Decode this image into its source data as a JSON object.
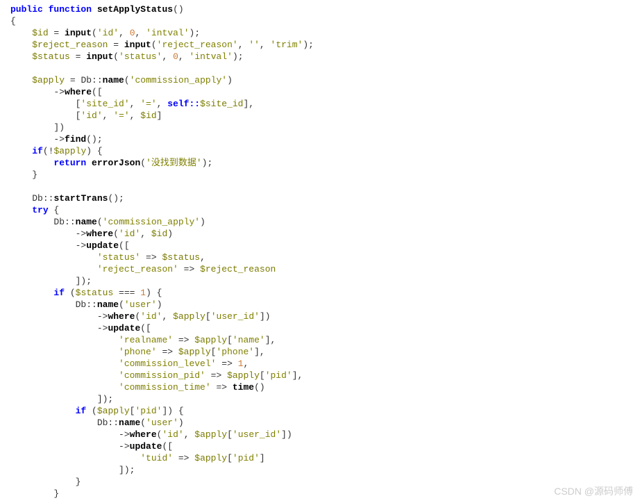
{
  "code": {
    "line1": {
      "public": "public",
      "function": "function",
      "name": "setApplyStatus",
      "paren": "()"
    },
    "line2": "{",
    "line3": {
      "indent": "    ",
      "var": "$id",
      "assign": " = ",
      "fn": "input",
      "open": "(",
      "arg1": "'id'",
      "sep1": ", ",
      "arg2": "0",
      "sep2": ", ",
      "arg3": "'intval'",
      "close": ");"
    },
    "line4": {
      "indent": "    ",
      "var": "$reject_reason",
      "assign": " = ",
      "fn": "input",
      "open": "(",
      "arg1": "'reject_reason'",
      "sep1": ", ",
      "arg2": "''",
      "sep2": ", ",
      "arg3": "'trim'",
      "close": ");"
    },
    "line5": {
      "indent": "    ",
      "var": "$status",
      "assign": " = ",
      "fn": "input",
      "open": "(",
      "arg1": "'status'",
      "sep1": ", ",
      "arg2": "0",
      "sep2": ", ",
      "arg3": "'intval'",
      "close": ");"
    },
    "line6": "",
    "line7": {
      "indent": "    ",
      "var": "$apply",
      "assign": " = ",
      "cls": "Db::",
      "fn": "name",
      "open": "(",
      "arg": "'commission_apply'",
      "close": ")"
    },
    "line8": {
      "indent": "        ->",
      "fn": "where",
      "open": "(["
    },
    "line9": {
      "indent": "            [",
      "arg1": "'site_id'",
      "sep1": ", ",
      "arg2": "'='",
      "sep2": ", ",
      "kw": "self::",
      "var": "$site_id",
      "close": "],"
    },
    "line10": {
      "indent": "            [",
      "arg1": "'id'",
      "sep1": ", ",
      "arg2": "'='",
      "sep2": ", ",
      "var": "$id",
      "close": "]"
    },
    "line11": {
      "indent": "        ])"
    },
    "line12": {
      "indent": "        ->",
      "fn": "find",
      "close": "();"
    },
    "line13": {
      "indent": "    ",
      "kw": "if",
      "open": "(!",
      "var": "$apply",
      "close": ") {"
    },
    "line14": {
      "indent": "        ",
      "kw": "return",
      "sp": " ",
      "fn": "errorJson",
      "open": "(",
      "arg": "'没找到数据'",
      "close": ");"
    },
    "line15": {
      "indent": "    }"
    },
    "line16": "",
    "line17": {
      "indent": "    ",
      "cls": "Db::",
      "fn": "startTrans",
      "close": "();"
    },
    "line18": {
      "indent": "    ",
      "kw": "try",
      "close": " {"
    },
    "line19": {
      "indent": "        ",
      "cls": "Db::",
      "fn": "name",
      "open": "(",
      "arg": "'commission_apply'",
      "close": ")"
    },
    "line20": {
      "indent": "            ->",
      "fn": "where",
      "open": "(",
      "arg1": "'id'",
      "sep": ", ",
      "var": "$id",
      "close": ")"
    },
    "line21": {
      "indent": "            ->",
      "fn": "update",
      "open": "(["
    },
    "line22": {
      "indent": "                ",
      "key": "'status'",
      "arrow": " => ",
      "var": "$status",
      "close": ","
    },
    "line23": {
      "indent": "                ",
      "key": "'reject_reason'",
      "arrow": " => ",
      "var": "$reject_reason"
    },
    "line24": {
      "indent": "            ]);"
    },
    "line25": {
      "indent": "        ",
      "kw": "if",
      "open": " (",
      "var": "$status",
      "op": " === ",
      "num": "1",
      "close": ") {"
    },
    "line26": {
      "indent": "            ",
      "cls": "Db::",
      "fn": "name",
      "open": "(",
      "arg": "'user'",
      "close": ")"
    },
    "line27": {
      "indent": "                ->",
      "fn": "where",
      "open": "(",
      "arg1": "'id'",
      "sep": ", ",
      "var": "$apply",
      "idx": "[",
      "key": "'user_id'",
      "cidx": "]",
      "close": ")"
    },
    "line28": {
      "indent": "                ->",
      "fn": "update",
      "open": "(["
    },
    "line29": {
      "indent": "                    ",
      "key": "'realname'",
      "arrow": " => ",
      "var": "$apply",
      "idx": "[",
      "key2": "'name'",
      "cidx": "],"
    },
    "line30": {
      "indent": "                    ",
      "key": "'phone'",
      "arrow": " => ",
      "var": "$apply",
      "idx": "[",
      "key2": "'phone'",
      "cidx": "],"
    },
    "line31": {
      "indent": "                    ",
      "key": "'commission_level'",
      "arrow": " => ",
      "num": "1",
      "close": ","
    },
    "line32": {
      "indent": "                    ",
      "key": "'commission_pid'",
      "arrow": " => ",
      "var": "$apply",
      "idx": "[",
      "key2": "'pid'",
      "cidx": "],"
    },
    "line33": {
      "indent": "                    ",
      "key": "'commission_time'",
      "arrow": " => ",
      "fn": "time",
      "close": "()"
    },
    "line34": {
      "indent": "                ]);"
    },
    "line35": {
      "indent": "            ",
      "kw": "if",
      "open": " (",
      "var": "$apply",
      "idx": "[",
      "key": "'pid'",
      "cidx": "]",
      "close": ") {"
    },
    "line36": {
      "indent": "                ",
      "cls": "Db::",
      "fn": "name",
      "open": "(",
      "arg": "'user'",
      "close": ")"
    },
    "line37": {
      "indent": "                    ->",
      "fn": "where",
      "open": "(",
      "arg1": "'id'",
      "sep": ", ",
      "var": "$apply",
      "idx": "[",
      "key": "'user_id'",
      "cidx": "]",
      "close": ")"
    },
    "line38": {
      "indent": "                    ->",
      "fn": "update",
      "open": "(["
    },
    "line39": {
      "indent": "                        ",
      "key": "'tuid'",
      "arrow": " => ",
      "var": "$apply",
      "idx": "[",
      "key2": "'pid'",
      "cidx": "]"
    },
    "line40": {
      "indent": "                    ]);"
    },
    "line41": {
      "indent": "            }"
    },
    "line42": {
      "indent": "        }"
    }
  },
  "watermark": "CSDN @源码师傅"
}
